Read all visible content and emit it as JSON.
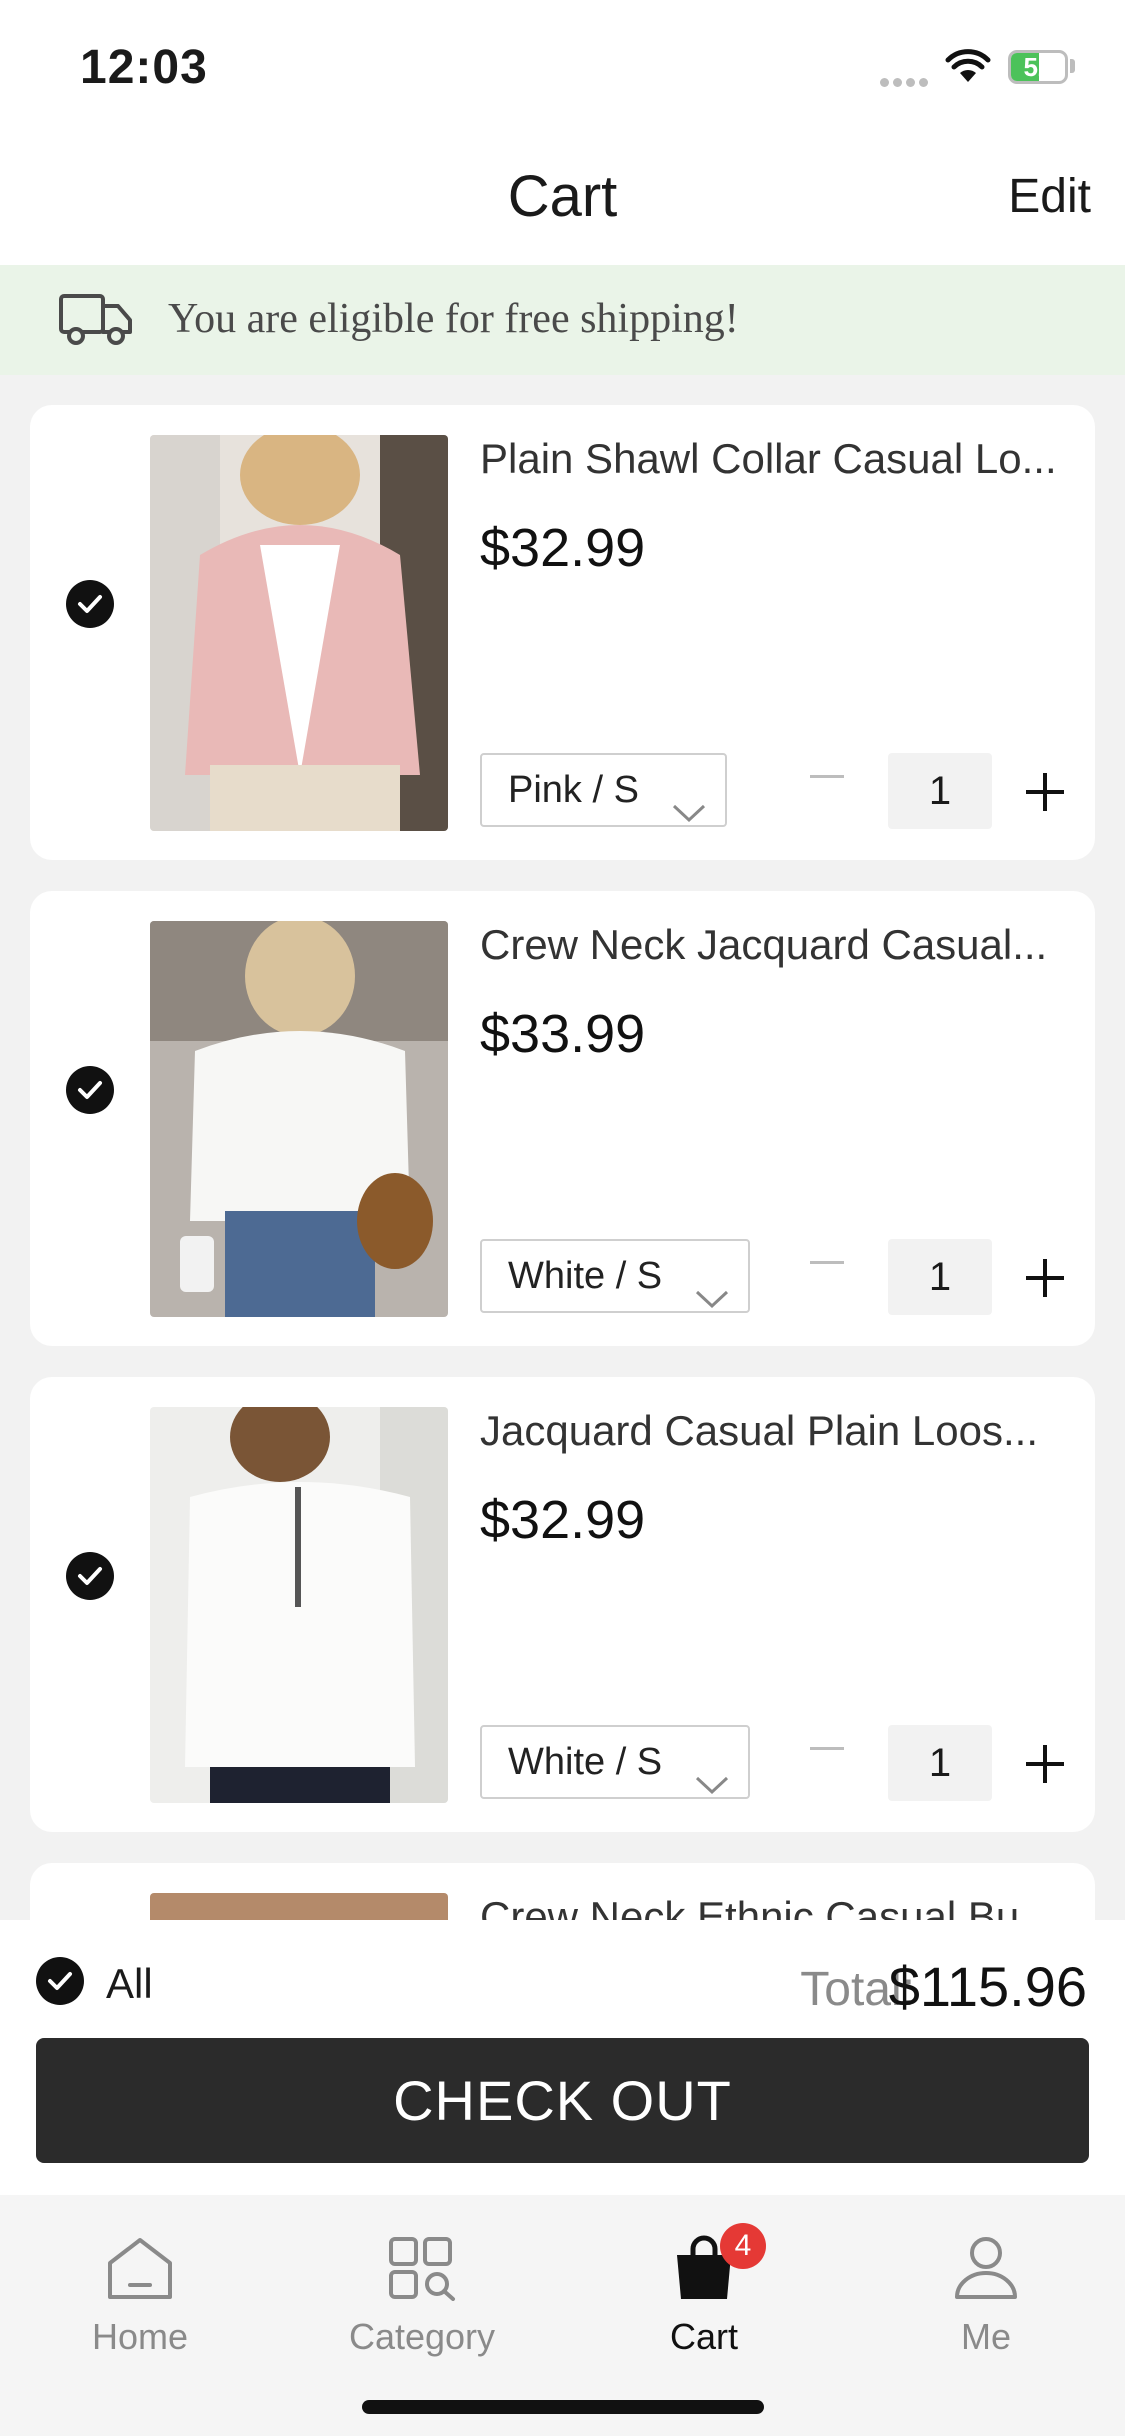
{
  "status_bar": {
    "time": "12:03",
    "battery": "52"
  },
  "header": {
    "title": "Cart",
    "edit_label": "Edit"
  },
  "banner": {
    "text": "You are eligible for free shipping!"
  },
  "items": [
    {
      "title": "Plain Shawl Collar Casual Lo...",
      "price": "$32.99",
      "variant": "Pink / S",
      "quantity": "1"
    },
    {
      "title": "Crew Neck Jacquard Casual...",
      "price": "$33.99",
      "variant": "White / S",
      "quantity": "1"
    },
    {
      "title": "Jacquard Casual Plain Loos...",
      "price": "$32.99",
      "variant": "White / S",
      "quantity": "1"
    },
    {
      "title": "Crew Neck Ethnic Casual Bu..."
    }
  ],
  "summary": {
    "all_label": "All",
    "total_label": "Total:",
    "total_value": "$115.96",
    "checkout_label": "CHECK OUT"
  },
  "tabbar": {
    "tabs": [
      {
        "label": "Home",
        "icon": "home-icon"
      },
      {
        "label": "Category",
        "icon": "category-icon"
      },
      {
        "label": "Cart",
        "icon": "bag-icon",
        "badge": "4"
      },
      {
        "label": "Me",
        "icon": "person-icon"
      }
    ]
  },
  "colors": {
    "accent": "#111111",
    "badge": "#e53935",
    "banner_bg": "#eaf4e8",
    "battery": "#4cc25a"
  }
}
